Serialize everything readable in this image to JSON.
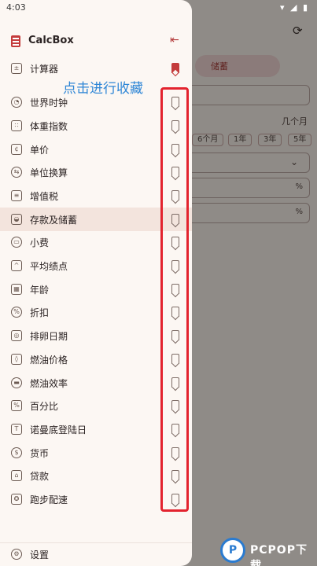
{
  "status_bar": {
    "time": "4:03",
    "icons": "▾ ◢ ▮"
  },
  "drawer": {
    "app_title": "CalcBox",
    "items": [
      {
        "label": "计算器",
        "icon": "calculator-icon",
        "glyph": "±",
        "bookmarked": true
      },
      {
        "label": "世界时钟",
        "icon": "world-clock-icon",
        "glyph": "◔"
      },
      {
        "label": "体重指数",
        "icon": "bmi-icon",
        "glyph": "∷"
      },
      {
        "label": "单价",
        "icon": "unit-price-icon",
        "glyph": "¢"
      },
      {
        "label": "单位换算",
        "icon": "unit-convert-icon",
        "glyph": "⇆"
      },
      {
        "label": "增值税",
        "icon": "vat-icon",
        "glyph": "≡"
      },
      {
        "label": "存款及储蓄",
        "icon": "piggy-bank-icon",
        "glyph": "◒",
        "active": true
      },
      {
        "label": "小费",
        "icon": "wallet-icon",
        "glyph": "▭"
      },
      {
        "label": "平均绩点",
        "icon": "graduation-cap-icon",
        "glyph": "^"
      },
      {
        "label": "年龄",
        "icon": "calendar-icon",
        "glyph": "▦"
      },
      {
        "label": "折扣",
        "icon": "discount-icon",
        "glyph": "%"
      },
      {
        "label": "排卵日期",
        "icon": "ovulation-calendar-icon",
        "glyph": "◎"
      },
      {
        "label": "燃油价格",
        "icon": "fuel-drop-icon",
        "glyph": "◊"
      },
      {
        "label": "燃油效率",
        "icon": "car-icon",
        "glyph": "▬"
      },
      {
        "label": "百分比",
        "icon": "percent-icon",
        "glyph": "%"
      },
      {
        "label": "诺曼底登陆日",
        "icon": "d-day-calendar-icon",
        "glyph": "T"
      },
      {
        "label": "货币",
        "icon": "currency-icon",
        "glyph": "$"
      },
      {
        "label": "贷款",
        "icon": "bank-icon",
        "glyph": "⌂"
      },
      {
        "label": "跑步配速",
        "icon": "medal-icon",
        "glyph": "✪"
      }
    ],
    "settings_label": "设置"
  },
  "annotation": {
    "text": "点击进行收藏"
  },
  "background": {
    "tab_label": "储蓄",
    "months_label": "几个月",
    "chips": [
      "6个月",
      "1年",
      "3年",
      "5年"
    ],
    "percent_1": "%",
    "percent_2": "%"
  },
  "watermark": {
    "logo": "P",
    "text": "PCPOP下载"
  },
  "colors": {
    "accent": "#c43b3b",
    "annotation_blue": "#2e86d6",
    "annotation_red": "#e3232e"
  }
}
